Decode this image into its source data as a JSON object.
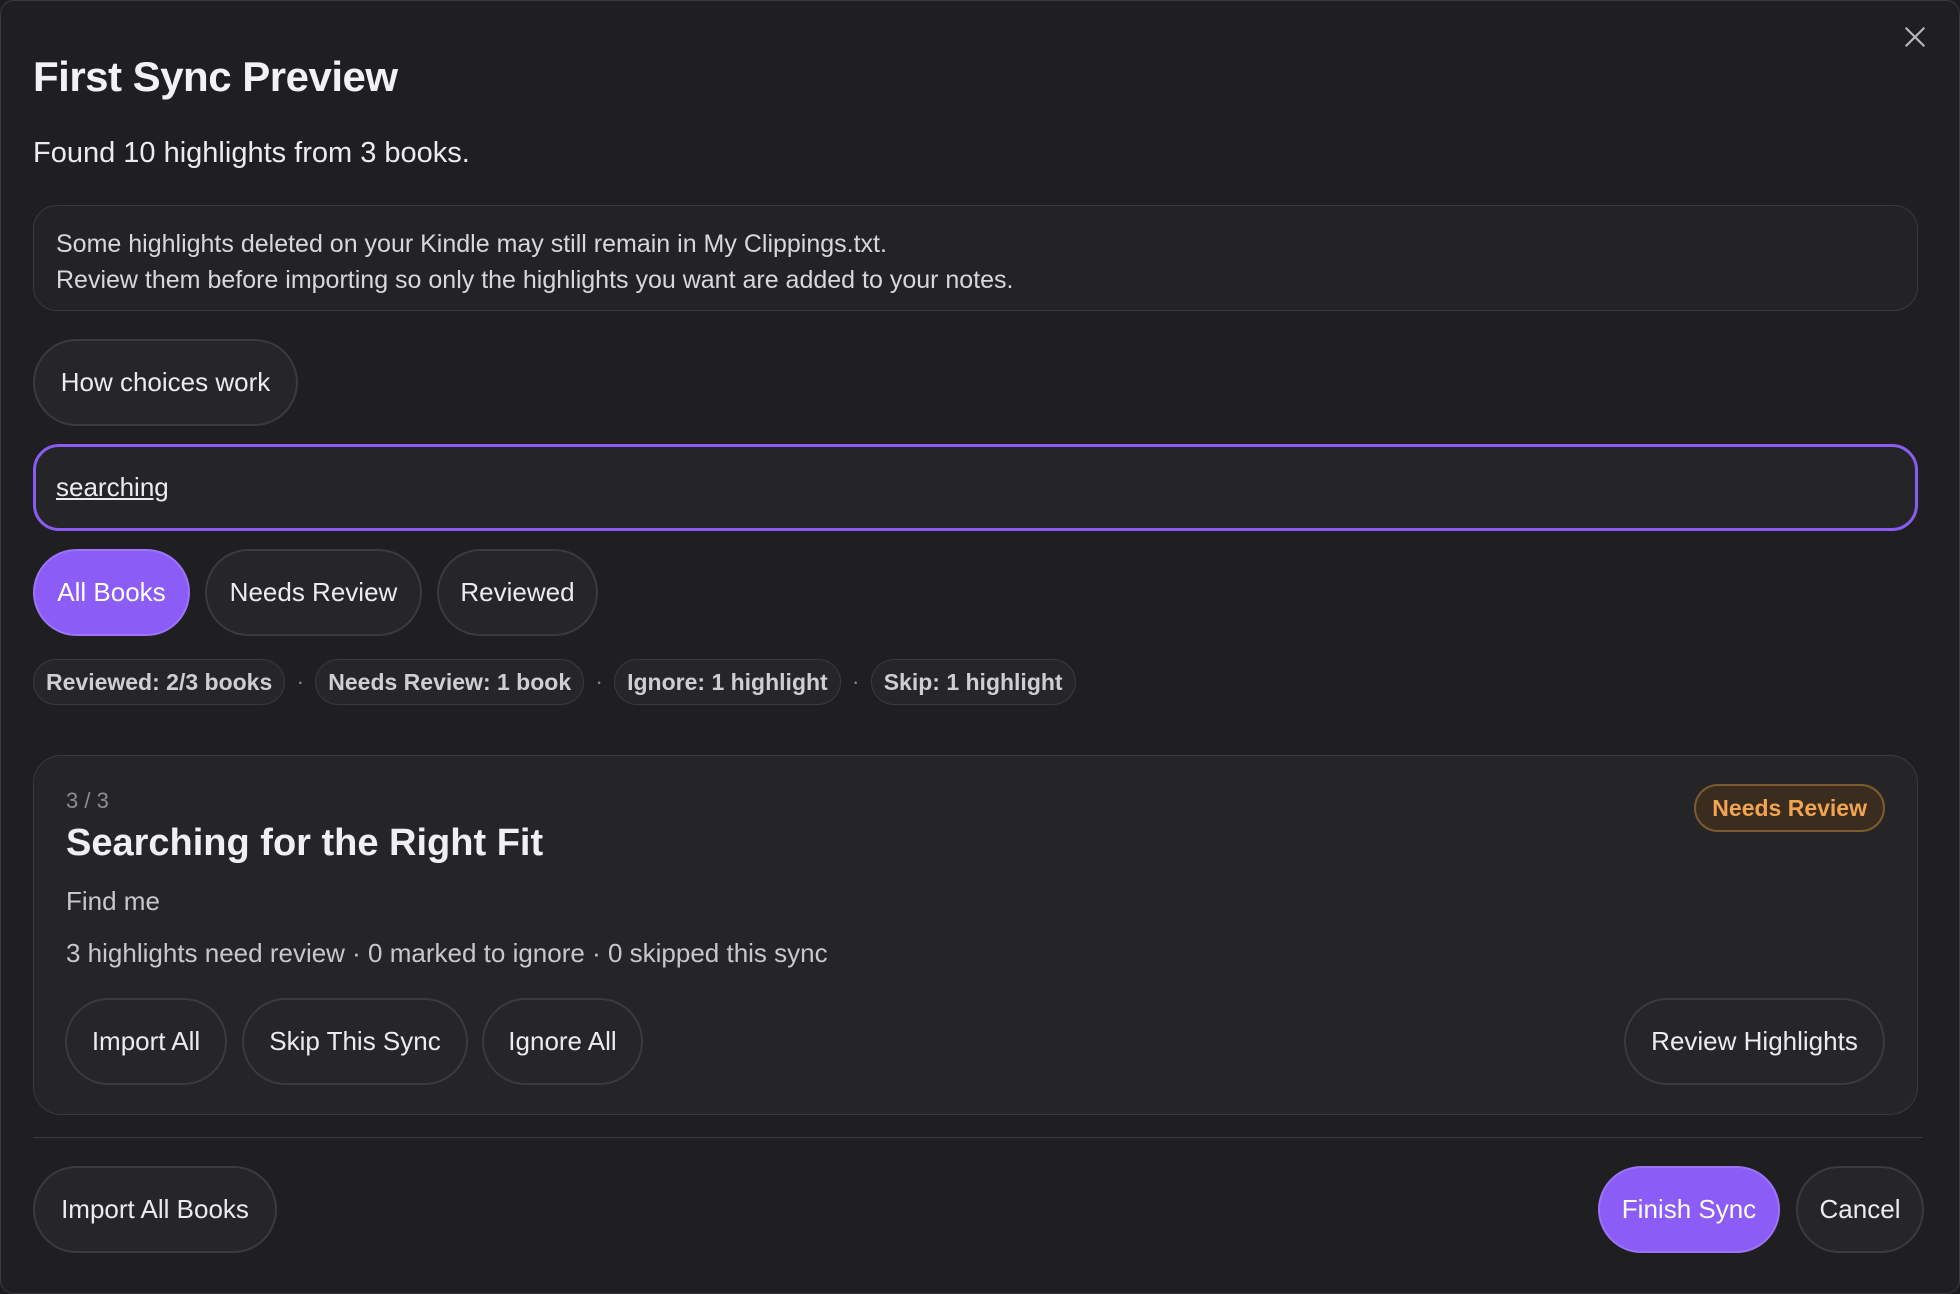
{
  "dialog": {
    "title": "First Sync Preview",
    "summary": "Found 10 highlights from 3 books.",
    "notice_line1": "Some highlights deleted on your Kindle may still remain in My Clippings.txt.",
    "notice_line2": "Review them before importing so only the highlights you want are added to your notes.",
    "how_choices_label": "How choices work"
  },
  "search": {
    "value": "searching"
  },
  "filters": [
    {
      "label": "All Books",
      "active": true
    },
    {
      "label": "Needs Review",
      "active": false
    },
    {
      "label": "Reviewed",
      "active": false
    }
  ],
  "stats": [
    "Reviewed: 2/3 books",
    "Needs Review: 1 book",
    "Ignore: 1 highlight",
    "Skip: 1 highlight"
  ],
  "stat_separator": "·",
  "book_card": {
    "counter": "3 / 3",
    "title": "Searching for the Right Fit",
    "author": "Find me",
    "stats": "3 highlights need review · 0 marked to ignore · 0 skipped this sync",
    "badge": "Needs Review",
    "actions": {
      "import_all": "Import All",
      "skip_sync": "Skip This Sync",
      "ignore_all": "Ignore All",
      "review": "Review Highlights"
    }
  },
  "footer": {
    "import_all_books": "Import All Books",
    "finish_sync": "Finish Sync",
    "cancel": "Cancel"
  },
  "colors": {
    "accent": "#8b5cf6",
    "badge_text": "#f2a450",
    "background": "#1f1f21"
  }
}
